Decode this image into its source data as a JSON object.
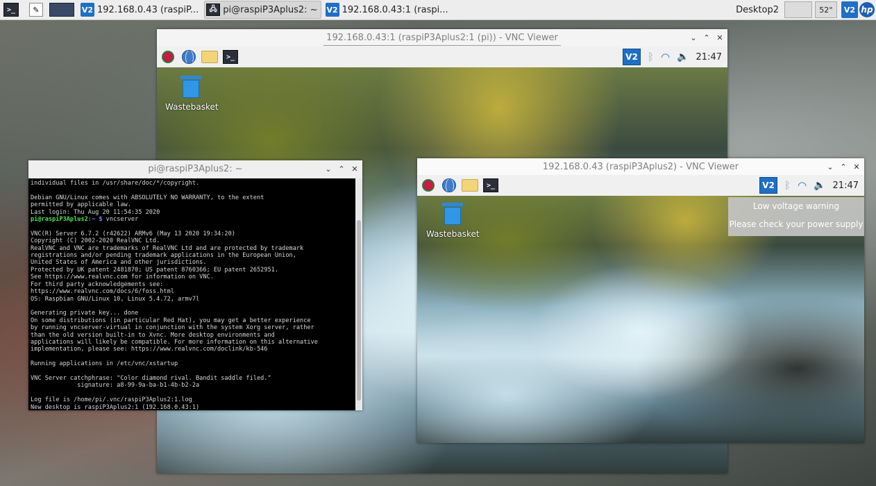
{
  "host_taskbar": {
    "items": [
      {
        "label": "",
        "icon": "terminal-icon"
      },
      {
        "label": "",
        "icon": "text-editor-icon"
      },
      {
        "label": "",
        "icon": "network-icon"
      },
      {
        "label": "192.168.0.43 (raspiP...",
        "icon": "vnc-icon"
      },
      {
        "label": "pi@raspiP3Aplus2: ~",
        "icon": "terminal-icon"
      },
      {
        "label": "192.168.0.43:1 (raspi...",
        "icon": "vnc-icon"
      }
    ],
    "desktop_label": "Desktop2",
    "temperature": "52°",
    "vnc_badge": "V2",
    "hp_badge": "hp"
  },
  "vnc_window_1": {
    "title": "192.168.0.43:1 (raspiP3Aplus2:1 (pi)) - VNC Viewer",
    "clock": "21:47",
    "vnc_badge": "V2",
    "wastebasket_label": "Wastebasket"
  },
  "vnc_window_2": {
    "title": "192.168.0.43 (raspiP3Aplus2) - VNC Viewer",
    "clock": "21:47",
    "vnc_badge": "V2",
    "wastebasket_label": "Wastebasket",
    "notification": {
      "title": "Low voltage warning",
      "message": "Please check your power supply"
    }
  },
  "terminal_window": {
    "title": "pi@raspiP3Aplus2: ~",
    "lines": [
      "individual files in /usr/share/doc/*/copyright.",
      "",
      "Debian GNU/Linux comes with ABSOLUTELY NO WARRANTY, to the extent",
      "permitted by applicable law.",
      "Last login: Thu Aug 20 11:54:35 2020",
      "",
      "VNC(R) Server 6.7.2 (r42622) ARMv6 (May 13 2020 19:34:20)",
      "Copyright (C) 2002-2020 RealVNC Ltd.",
      "RealVNC and VNC are trademarks of RealVNC Ltd and are protected by trademark",
      "registrations and/or pending trademark applications in the European Union,",
      "United States of America and other jurisdictions.",
      "Protected by UK patent 2481870; US patent 8760366; EU patent 2652951.",
      "See https://www.realvnc.com for information on VNC.",
      "For third party acknowledgements see:",
      "https://www.realvnc.com/docs/6/foss.html",
      "OS: Raspbian GNU/Linux 10, Linux 5.4.72, armv7l",
      "",
      "Generating private key... done",
      "On some distributions (in particular Red Hat), you may get a better experience",
      "by running vncserver-virtual in conjunction with the system Xorg server, rather",
      "than the old version built-in to Xvnc. More desktop environments and",
      "applications will likely be compatible. For more information on this alternative",
      "implementation, please see: https://www.realvnc.com/doclink/kb-546",
      "",
      "Running applications in /etc/vnc/xstartup",
      "",
      "VNC Server catchphrase: \"Color diamond rival. Bandit saddle filed.\"",
      "             signature: a8-99-9a-ba-b1-4b-b2-2a",
      "",
      "Log file is /home/pi/.vnc/raspiP3Aplus2:1.log",
      "New desktop is raspiP3Aplus2:1 (192.168.0.43:1)"
    ],
    "prompt_user": "pi@raspiP3Aplus2",
    "prompt_path": ":~ $",
    "command_1": " vncserver",
    "prompt_path_final": ":~ $"
  },
  "colors": {
    "vnc_blue": "#1f6fc5",
    "prompt_green": "#4de34d",
    "terminal_bg": "#000000"
  }
}
